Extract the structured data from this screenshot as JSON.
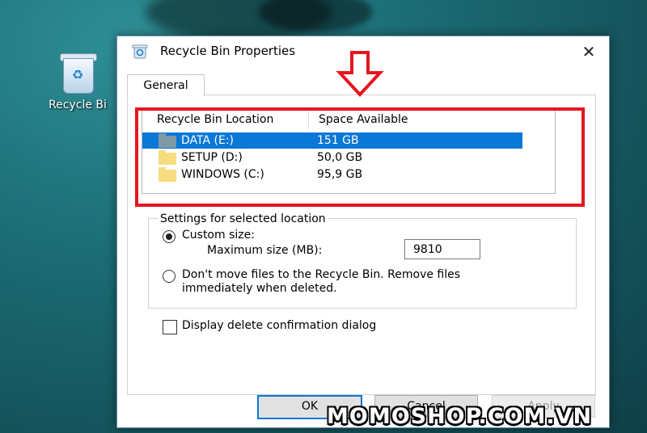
{
  "desktop": {
    "icon_label": "Recycle Bi",
    "icon": "recycle-bin-icon"
  },
  "dialog": {
    "title": "Recycle Bin Properties",
    "close_icon": "close-icon",
    "tabs": [
      {
        "label": "General"
      }
    ],
    "list": {
      "columns": [
        "Recycle Bin Location",
        "Space Available"
      ],
      "rows": [
        {
          "drive": "DATA (E:)",
          "space": "151 GB",
          "selected": true
        },
        {
          "drive": "SETUP (D:)",
          "space": "50,0 GB",
          "selected": false
        },
        {
          "drive": "WINDOWS (C:)",
          "space": "95,9 GB",
          "selected": false
        }
      ]
    },
    "settings": {
      "group_label": "Settings for selected location",
      "custom_size_label": "Custom size:",
      "max_size_label": "Maximum size (MB):",
      "max_size_value": "9810",
      "dont_move_label_line1": "Don't move files to the Recycle Bin. Remove files",
      "dont_move_label_line2": "immediately when deleted.",
      "custom_size_selected": true
    },
    "confirm_checkbox_label": "Display delete confirmation dialog",
    "confirm_checked": false,
    "buttons": {
      "ok": "OK",
      "cancel": "Cancel",
      "apply": "Apply"
    }
  },
  "annotations": {
    "highlight_color": "#e5161f",
    "arrow_icon": "down-arrow-icon"
  },
  "watermark": "MOMOSHOP.COM.VN",
  "colors": {
    "selection": "#0a78d7",
    "accent": "#0a78d7"
  }
}
